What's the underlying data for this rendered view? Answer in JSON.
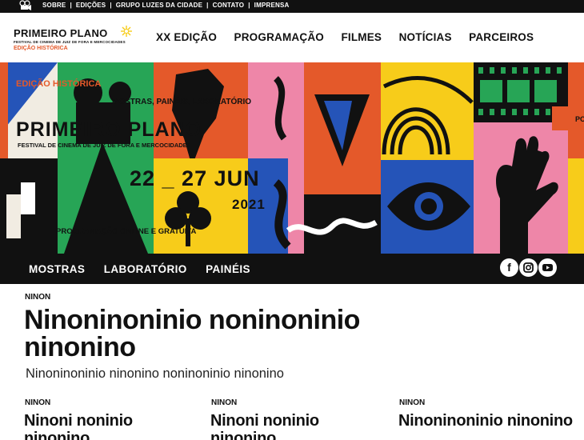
{
  "topbar": {
    "icon": "film-camera-icon",
    "links": [
      "SOBRE",
      "EDIÇÕES",
      "GRUPO LUZES DA CIDADE",
      "CONTATO",
      "IMPRENSA"
    ]
  },
  "header": {
    "logo_name": "PRIMEIRO PLANO",
    "logo_sub": "FESTIVAL DE CINEMA DE JUIZ DE FORA E MERCOCIDADES",
    "logo_edition": "EDIÇÃO HISTÓRICA",
    "nav": [
      "XX EDIÇÃO",
      "PROGRAMAÇÃO",
      "FILMES",
      "NOTÍCIAS",
      "PARCEIROS"
    ]
  },
  "banner": {
    "edition": "EDIÇÃO HISTÓRICA",
    "tagline": "MOSTRAS, PAINÉIS, LABORATÓRIO",
    "title": "PRIMEIRO PLANO",
    "subtitle": "FESTIVAL DE CINEMA DE JUIZ DE FORA E MERCOCIDADES",
    "dates": "22 _ 27 JUN",
    "year": "2021",
    "note": "PROGRAMAÇÃO ONLINE E GRATUITA",
    "edge_text": "PO",
    "colors": {
      "green": "#27a556",
      "orange": "#e4592a",
      "yellow": "#f7cc1a",
      "pink": "#ee86a8",
      "blue": "#2554b8",
      "black": "#111111",
      "cream": "#f1ece2"
    }
  },
  "subnav": {
    "items": [
      "MOSTRAS",
      "LABORATÓRIO",
      "PAINÉIS"
    ],
    "social": [
      "facebook-icon",
      "instagram-icon",
      "youtube-icon"
    ]
  },
  "main": {
    "kicker": "NINON",
    "headline": "Ninoninoninio noninoninio ninonino",
    "lead": "Ninoninoninio ninonino noninoninio ninonino",
    "cards": [
      {
        "kicker": "NINON",
        "title": "Ninoni noninio ninonino"
      },
      {
        "kicker": "NINON",
        "title": "Ninoni noninio ninonino"
      },
      {
        "kicker": "NINON",
        "title": "Ninoninoninio ninonino"
      }
    ]
  }
}
